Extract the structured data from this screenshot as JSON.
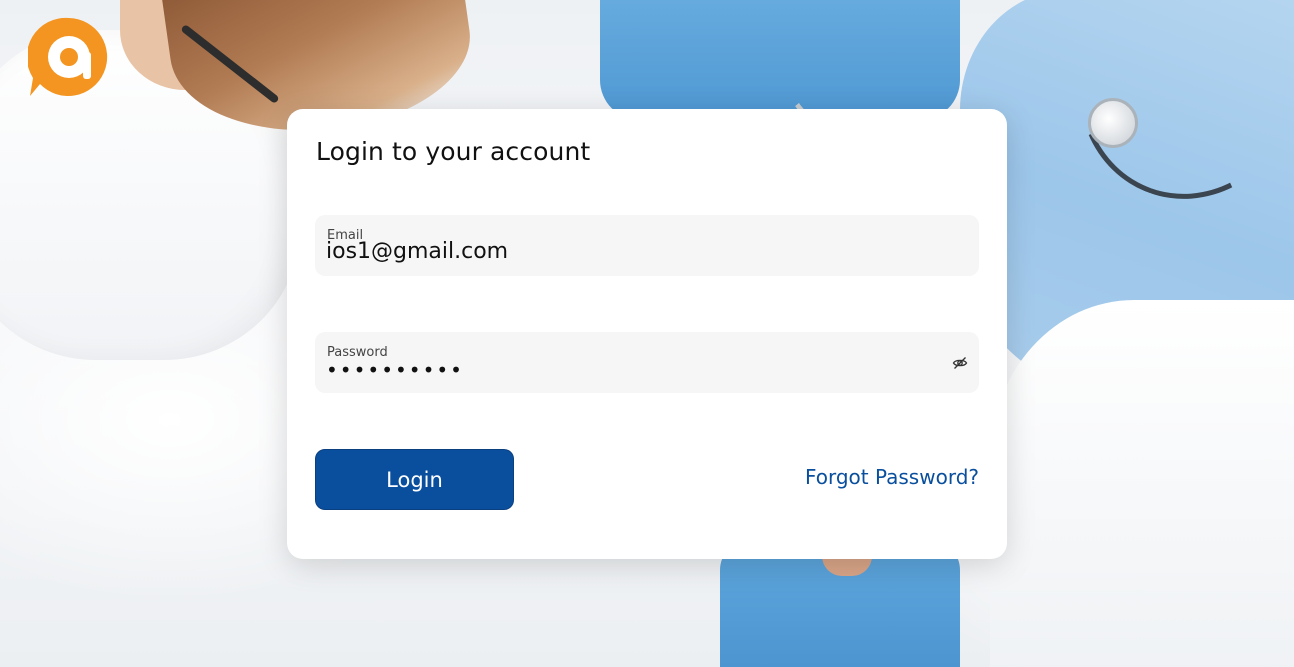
{
  "branding": {
    "logo_icon": "brand-logo-icon",
    "accent_color": "#f39520"
  },
  "login": {
    "title": "Login to your account",
    "email": {
      "label": "Email",
      "value": "ios1@gmail.com"
    },
    "password": {
      "label": "Password",
      "masked_value": "••••••••••",
      "toggle_icon": "eye-off-icon"
    },
    "login_label": "Login",
    "forgot_label": "Forgot Password?",
    "primary_color": "#0a4f9e"
  },
  "background": {
    "image_subject": "medical-staff-photo"
  }
}
